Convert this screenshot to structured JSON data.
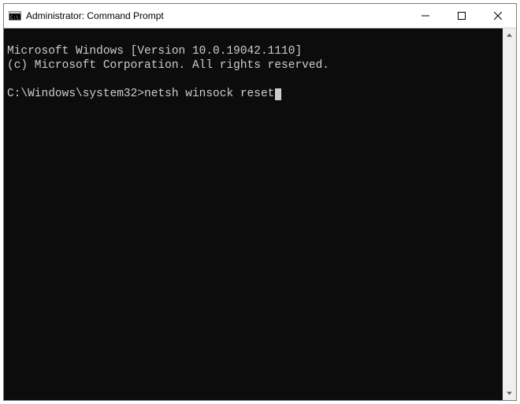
{
  "window": {
    "title": "Administrator: Command Prompt"
  },
  "terminal": {
    "line1": "Microsoft Windows [Version 10.0.19042.1110]",
    "line2": "(c) Microsoft Corporation. All rights reserved.",
    "blank": "",
    "prompt": "C:\\Windows\\system32>",
    "command": "netsh winsock reset"
  },
  "icons": {
    "app": "cmd-icon",
    "minimize": "minimize-icon",
    "maximize": "maximize-icon",
    "close": "close-icon",
    "scroll_up": "chevron-up-icon",
    "scroll_down": "chevron-down-icon"
  }
}
